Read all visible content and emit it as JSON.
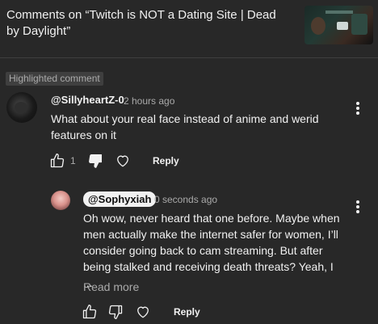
{
  "header": {
    "title": "Comments on “Twitch is NOT a Dating Site | Dead by Daylight”",
    "thumbnail_icon": "video-thumbnail"
  },
  "highlight_label": "Highlighted comment",
  "comment": {
    "author": "@SillyheartZ-0",
    "time": "2 hours ago",
    "text": "What about your real face instead of anime and werid features on it",
    "like_count": "1",
    "reply_label": "Reply"
  },
  "reply": {
    "author": "@Sophyxiah",
    "time": "0 seconds ago",
    "text": "Oh wow, never heard that one before. Maybe when men actually make the internet safer for women, I’ll consider going back to cam streaming. But after being stalked and receiving death threats? Yeah, I ...",
    "read_more": "Read more",
    "reply_label": "Reply"
  },
  "colors": {
    "background": "#282828",
    "text": "#f1f1f1",
    "secondary_text": "#aaaaaa",
    "badge_bg": "#3f3f3f",
    "chip_bg": "#f1f1f1"
  }
}
